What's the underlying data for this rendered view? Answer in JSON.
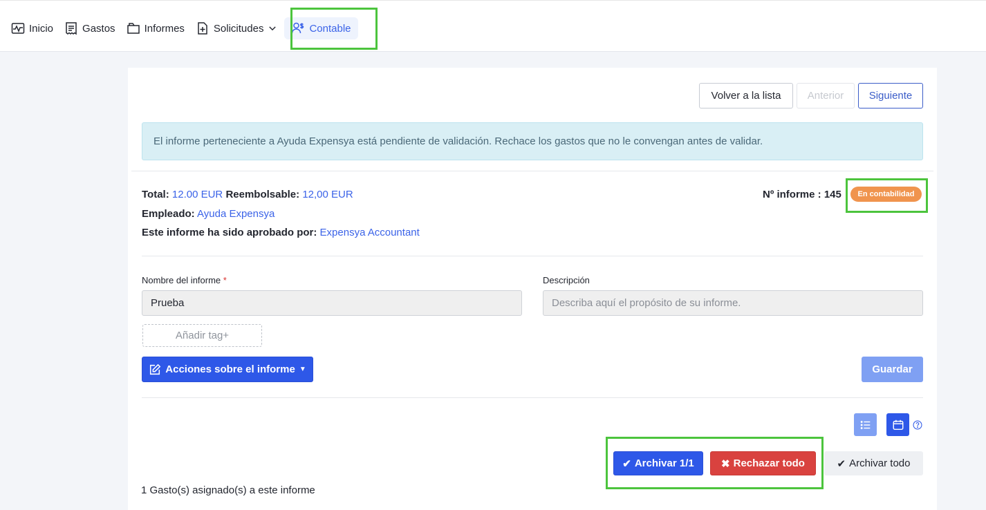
{
  "nav": {
    "items": [
      {
        "label": "Inicio",
        "icon": "pulse-chart-icon"
      },
      {
        "label": "Gastos",
        "icon": "receipt-icon"
      },
      {
        "label": "Informes",
        "icon": "folder-icon"
      },
      {
        "label": "Solicitudes",
        "icon": "file-plus-icon"
      },
      {
        "label": "Contable",
        "icon": "user-dollar-icon"
      }
    ]
  },
  "toolbar": {
    "back_label": "Volver a la lista",
    "prev_label": "Anterior",
    "next_label": "Siguiente"
  },
  "alert": {
    "text": "El informe perteneciente a Ayuda Expensya está pendiente de validación. Rechace los gastos que no le convengan antes de validar."
  },
  "summary": {
    "total_label": "Total:",
    "total_value": "12.00 EUR",
    "refund_label": "Reembolsable:",
    "refund_value": "12,00 EUR",
    "employee_label": "Empleado:",
    "employee_value": "Ayuda Expensya",
    "approved_label": "Este informe ha sido aprobado por:",
    "approved_value": "Expensya Accountant",
    "report_no_label": "Nº informe : 145",
    "status_badge": "En contabilidad"
  },
  "form": {
    "name_label": "Nombre del informe",
    "name_required": "*",
    "name_value": "Prueba",
    "desc_label": "Descripción",
    "desc_placeholder": "Describa aquí el propósito de su informe.",
    "tag_add_label": "Añadir tag+",
    "actions_label": "Acciones sobre el informe",
    "save_label": "Guardar"
  },
  "actions": {
    "archive_one_label": "Archivar 1/1",
    "reject_all_label": "Rechazar todo",
    "archive_all_label": "Archivar todo"
  },
  "footer": {
    "assigned_text": "1 Gasto(s) asignado(s) a este informe"
  },
  "colors": {
    "primary": "#2e58e8",
    "danger": "#d9423f",
    "badge": "#f0944e",
    "highlight": "#4cc43d"
  }
}
